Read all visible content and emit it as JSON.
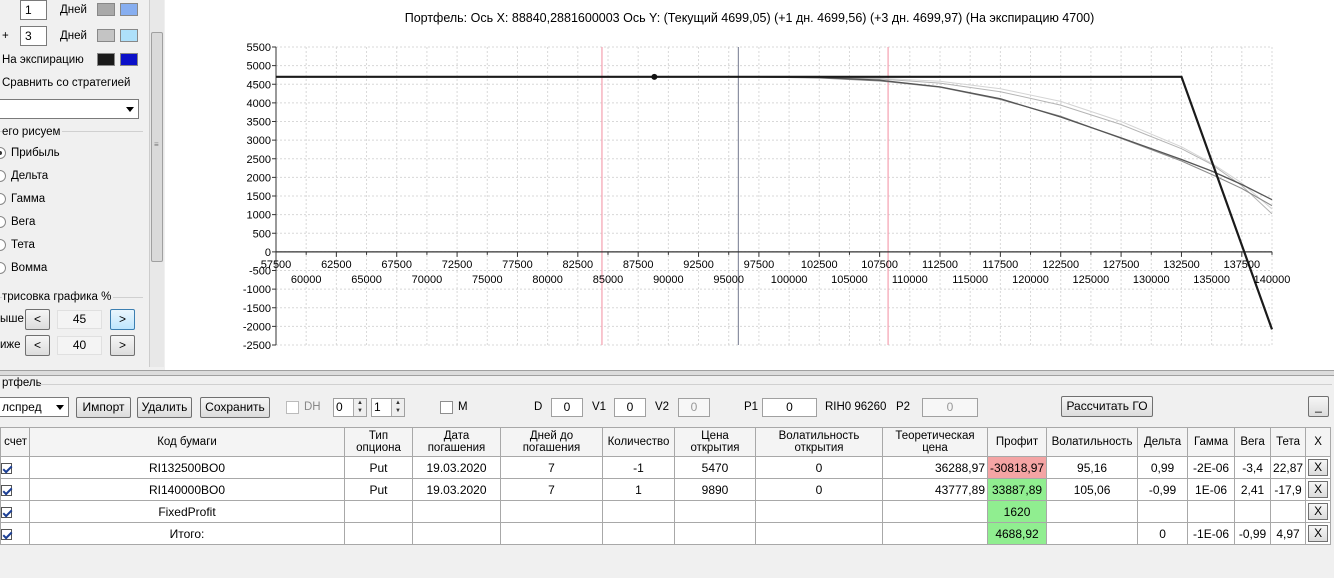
{
  "left_panel": {
    "days_row1": {
      "prefix": "",
      "value": "1",
      "unit": "Дней",
      "color_a": "#a9a9a9",
      "color_b": "#87aef0"
    },
    "days_row2": {
      "prefix": "+",
      "value": "3",
      "unit": "Дней",
      "color_a": "#c4c4c4",
      "color_b": "#aee0fa"
    },
    "expiry_row": {
      "label": "На экспирацию",
      "color_a": "#1a1a1a",
      "color_b": "#0b10c8"
    },
    "compare_label": "Сравнить со стратегией",
    "draw_group_title": "его рисуем",
    "draw_options": [
      "Прибыль",
      "Дельта",
      "Гамма",
      "Вега",
      "Тета",
      "Вомма"
    ],
    "draw_selected": 0,
    "render_group_title": "трисовка графика %",
    "above_label": "ыше",
    "above_value": "45",
    "below_label": "иже",
    "below_value": "40",
    "btn_prev": "<",
    "btn_next": ">"
  },
  "chart_data": {
    "type": "line",
    "title": "Портфель: Ось X:  88840,2881600003 Ось Y:  (Текущий 4699,05)  (+1 дн. 4699,56)  (+3 дн. 4699,97)  (На экспирацию 4700)",
    "xlabel": "",
    "ylabel": "",
    "xlim": [
      57500,
      140000
    ],
    "ylim": [
      -2500,
      5500
    ],
    "x_ticks_top": [
      57500,
      62500,
      67500,
      72500,
      77500,
      82500,
      87500,
      92500,
      97500,
      102500,
      107500,
      112500,
      117500,
      122500,
      127500,
      132500,
      137500
    ],
    "x_ticks_bottom": [
      60000,
      65000,
      70000,
      75000,
      80000,
      85000,
      90000,
      95000,
      100000,
      105000,
      110000,
      115000,
      120000,
      125000,
      130000,
      135000,
      140000
    ],
    "y_ticks": [
      5500,
      5000,
      4500,
      4000,
      3500,
      3000,
      2500,
      2000,
      1500,
      1000,
      500,
      0,
      -500,
      -1000,
      -1500,
      -2000,
      -2500
    ],
    "grid": true,
    "vlines": [
      {
        "x": 84500,
        "color": "#f4a0b0"
      },
      {
        "x": 95800,
        "color": "#8a8fa0"
      },
      {
        "x": 108200,
        "color": "#f4a0b0"
      }
    ],
    "cursor_point": {
      "x": 88840,
      "y": 4699
    },
    "series": [
      {
        "color": "#1a1a1a",
        "width": 2.2,
        "x": [
          57500,
          132500,
          140000
        ],
        "y": [
          4700,
          4700,
          -2080
        ]
      },
      {
        "color": "#555555",
        "width": 1.3,
        "x": [
          57500,
          95800,
          102500,
          107500,
          112500,
          117500,
          122500,
          127500,
          132500,
          135000,
          137500,
          140000
        ],
        "y": [
          4699,
          4699,
          4680,
          4610,
          4430,
          4110,
          3620,
          3060,
          2480,
          2170,
          1810,
          1400
        ]
      },
      {
        "color": "#8c8c8c",
        "width": 1.1,
        "x": [
          57500,
          95800,
          102500,
          107500,
          112500,
          117500,
          122500,
          127500,
          132500,
          135000,
          137500,
          140000
        ],
        "y": [
          4699,
          4699,
          4670,
          4590,
          4420,
          4090,
          3640,
          3050,
          2440,
          2080,
          1700,
          1240
        ]
      },
      {
        "color": "#b4b4b4",
        "width": 1.0,
        "x": [
          57500,
          95800,
          102500,
          107500,
          112500,
          117500,
          122500,
          127500,
          132500,
          135000,
          137500,
          140000
        ],
        "y": [
          4700,
          4700,
          4680,
          4640,
          4530,
          4300,
          3940,
          3420,
          2770,
          2350,
          1780,
          1020
        ]
      },
      {
        "color": "#d4d4d4",
        "width": 1.0,
        "x": [
          57500,
          95800,
          102500,
          107500,
          112500,
          117500,
          122500,
          127500,
          132500,
          135000,
          137500,
          140000
        ],
        "y": [
          4700,
          4700,
          4690,
          4660,
          4580,
          4380,
          4040,
          3500,
          2820,
          2380,
          1850,
          1150
        ]
      }
    ]
  },
  "portfolio": {
    "group_label": "ртфель",
    "strategy_value": "лспред",
    "btn_import": "Импорт",
    "btn_delete": "Удалить",
    "btn_save": "Сохранить",
    "dh_label": "DH",
    "spin1": "0",
    "spin2": "1",
    "m_label": "M",
    "d_label": "D",
    "d_value": "0",
    "v1_label": "V1",
    "v1_value": "0",
    "v2_label": "V2",
    "v2_value": "0",
    "p1_label": "P1",
    "p1_value": "0",
    "rih_label": "RIH0 96260",
    "p2_label": "P2",
    "p2_value": "0",
    "btn_calc": "Рассчитать ГО",
    "btn_min": "_"
  },
  "table": {
    "headers": [
      "счет",
      "Код бумаги",
      "Тип опциона",
      "Дата погашения",
      "Дней до погашения",
      "Количество",
      "Цена открытия",
      "Волатильность открытия",
      "Теоретическая цена",
      "Профит",
      "Волатильность",
      "Дельта",
      "Гамма",
      "Вега",
      "Тета",
      "X"
    ],
    "rows": [
      {
        "code": "RI132500BO0",
        "type": "Put",
        "date": "19.03.2020",
        "days": "7",
        "qty": "-1",
        "open_price": "5470",
        "open_vol": "0",
        "theo": "36288,97",
        "profit": "-30818,97",
        "vol": "95,16",
        "delta": "0,99",
        "gamma": "-2E-06",
        "vega": "-3,4",
        "theta": "22,87",
        "x": "X"
      },
      {
        "code": "RI140000BO0",
        "type": "Put",
        "date": "19.03.2020",
        "days": "7",
        "qty": "1",
        "open_price": "9890",
        "open_vol": "0",
        "theo": "43777,89",
        "profit": "33887,89",
        "vol": "105,06",
        "delta": "-0,99",
        "gamma": "1E-06",
        "vega": "2,41",
        "theta": "-17,9",
        "x": "X"
      },
      {
        "code": "FixedProfit",
        "type": "",
        "date": "",
        "days": "",
        "qty": "",
        "open_price": "",
        "open_vol": "",
        "theo": "",
        "profit": "1620",
        "vol": "",
        "delta": "",
        "gamma": "",
        "vega": "",
        "theta": "",
        "x": "X"
      },
      {
        "code": "Итого:",
        "type": "",
        "date": "",
        "days": "",
        "qty": "",
        "open_price": "",
        "open_vol": "",
        "theo": "",
        "profit": "4688,92",
        "vol": "",
        "delta": "0",
        "gamma": "-1E-06",
        "vega": "-0,99",
        "theta": "4,97",
        "x": "X"
      }
    ]
  }
}
